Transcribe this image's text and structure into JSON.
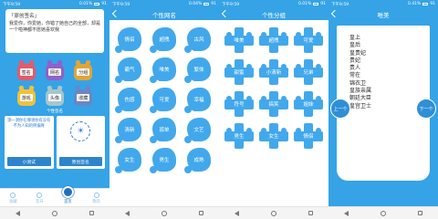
{
  "screens": [
    {
      "status": {
        "time": "下午9:59",
        "speed": "0.01%",
        "battery": "91"
      },
      "card": {
        "title": "「原创签名」",
        "text": "我爱你，你爱她，你错了她自己的全部，却是一个啦神都不愿她喜欢我"
      },
      "mascots": [
        {
          "label": "签名",
          "color": "#e55a6a"
        },
        {
          "label": "网名",
          "color": "#8f62c9"
        },
        {
          "label": "分组",
          "color": "#e0a535"
        },
        {
          "label": "游戏",
          "color": "#f0c23a"
        },
        {
          "label": "头像",
          "color": "#a7c6cc"
        },
        {
          "label": "收藏",
          "color": "#6a86c6"
        }
      ],
      "divider": "个性签名",
      "promos": [
        {
          "text": "测一测你在哪领你有没有不为人知的明偏骨",
          "button": "小测试"
        },
        {
          "text": "",
          "button": "原创签名"
        }
      ],
      "tabs": [
        {
          "label": "收藏"
        },
        {
          "label": "签开"
        },
        {
          "label": "首页",
          "active": true
        },
        {
          "label": "我的"
        }
      ]
    },
    {
      "status": {
        "time": "下午9:59",
        "speed": "0.04%",
        "battery": "91"
      },
      "title": "个性网名",
      "items": [
        "情侣",
        "超拽",
        "古风",
        "霸气",
        "唯美",
        "繁体",
        "伤感",
        "可爱",
        "幸福",
        "清新",
        "孤单",
        "文艺",
        "女生",
        "男生",
        "成熟"
      ]
    },
    {
      "status": {
        "time": "下午9:59",
        "speed": "0.01%",
        "battery": "91"
      },
      "title": "个性分组",
      "items": [
        "唯美",
        "超拽",
        "可爱",
        "甜蜜",
        "小清新",
        "兄弟",
        "符号",
        "搞笑",
        "姐妹",
        "男生",
        "女生",
        "情侣"
      ]
    },
    {
      "status": {
        "time": "下午9:59",
        "speed": "0.41%",
        "battery": "91"
      },
      "title": "唯美",
      "lines": [
        "皇上",
        "皇后",
        "皇贵妃",
        "贵妃",
        "贵人",
        "常在",
        "锦衣卫",
        "皇族亲属",
        "朝廷大臣",
        "皇宫卫士"
      ],
      "prev": "上一个",
      "next": "下一个"
    }
  ]
}
